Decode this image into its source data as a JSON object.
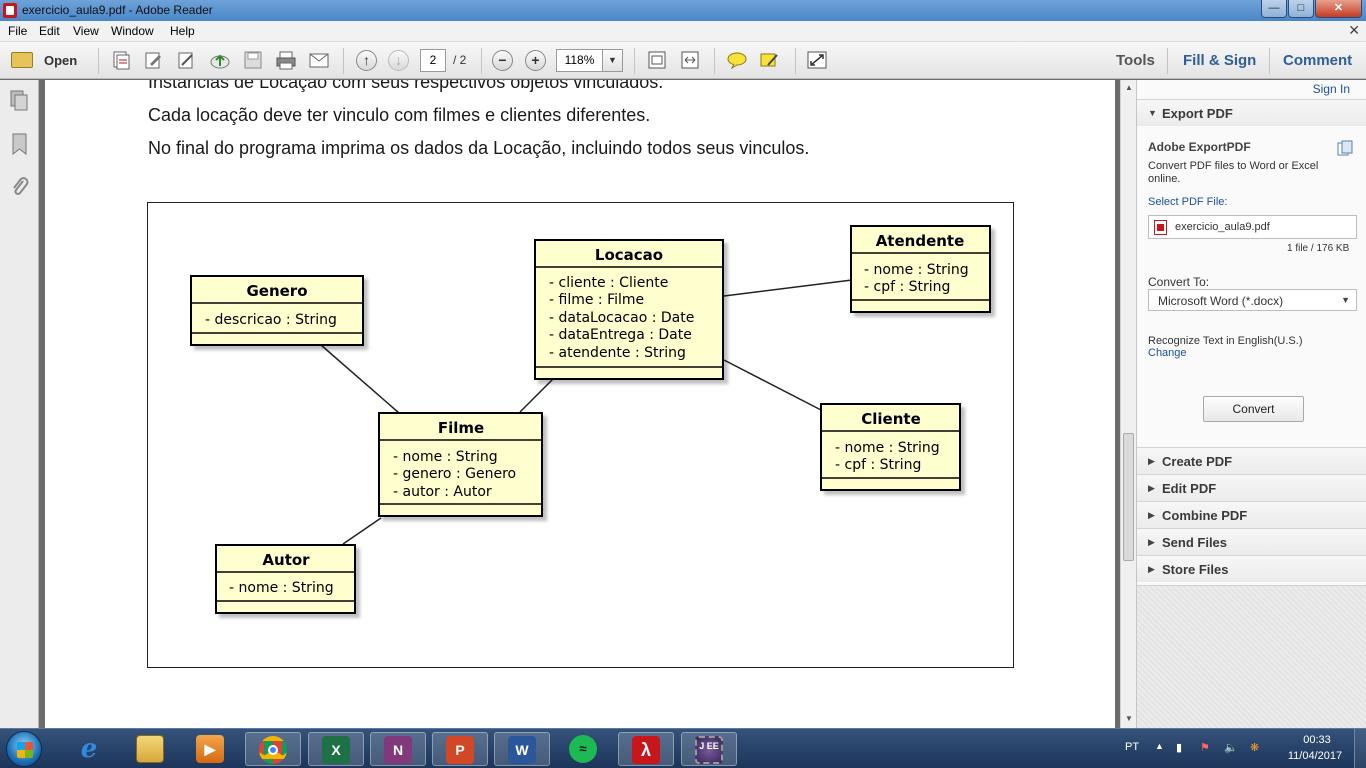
{
  "window": {
    "title": "exercicio_aula9.pdf - Adobe Reader"
  },
  "menu": [
    "File",
    "Edit",
    "View",
    "Window",
    "Help"
  ],
  "toolbar": {
    "open_label": "Open",
    "page_current": "2",
    "page_total": "/ 2",
    "zoom": "118%",
    "tools": "Tools",
    "fill_sign": "Fill & Sign",
    "comment": "Comment"
  },
  "document": {
    "lines": [
      "Instâncias de Locação com seus respectivos objetos vinculados.",
      "Cada locação deve ter vinculo com filmes e clientes diferentes.",
      "No final do programa imprima os dados da Locação, incluindo todos seus vinculos."
    ],
    "classes": {
      "genero": {
        "name": "Genero",
        "attrs": [
          "- descricao : String"
        ]
      },
      "locacao": {
        "name": "Locacao",
        "attrs": [
          "- cliente : Cliente",
          "- filme : Filme",
          "- dataLocacao : Date",
          "- dataEntrega : Date",
          "- atendente : String"
        ]
      },
      "atendente": {
        "name": "Atendente",
        "attrs": [
          "- nome : String",
          "- cpf : String"
        ]
      },
      "filme": {
        "name": "Filme",
        "attrs": [
          "- nome : String",
          "- genero : Genero",
          "- autor : Autor"
        ]
      },
      "cliente": {
        "name": "Cliente",
        "attrs": [
          "- nome : String",
          "- cpf : String"
        ]
      },
      "autor": {
        "name": "Autor",
        "attrs": [
          "- nome : String"
        ]
      }
    }
  },
  "right_panel": {
    "sign_in": "Sign In",
    "export_pdf": "Export PDF",
    "export_title": "Adobe ExportPDF",
    "export_desc_1": "Convert PDF files to Word or Excel",
    "export_desc_2": "online.",
    "select_label": "Select PDF File:",
    "file_name": "exercicio_aula9.pdf",
    "file_info": "1 file / 176 KB",
    "convert_to_label": "Convert To:",
    "convert_to_value": "Microsoft Word (*.docx)",
    "recognize_text": "Recognize Text in English(U.S.)",
    "change": "Change",
    "convert_button": "Convert",
    "sections": [
      "Create PDF",
      "Edit PDF",
      "Combine PDF",
      "Send Files",
      "Store Files"
    ]
  },
  "taskbar": {
    "language": "PT",
    "time": "00:33",
    "date": "11/04/2017",
    "apps": [
      "internet-explorer",
      "file-explorer",
      "media-player",
      "chrome",
      "excel",
      "onenote",
      "powerpoint",
      "word",
      "spotify",
      "adobe-reader",
      "java-ee-ide"
    ]
  },
  "colors": {
    "uml_fill": "#fefece",
    "uml_border": "#000000",
    "accent_link": "#1a4f9c",
    "title_bar": "#4a86c7"
  }
}
